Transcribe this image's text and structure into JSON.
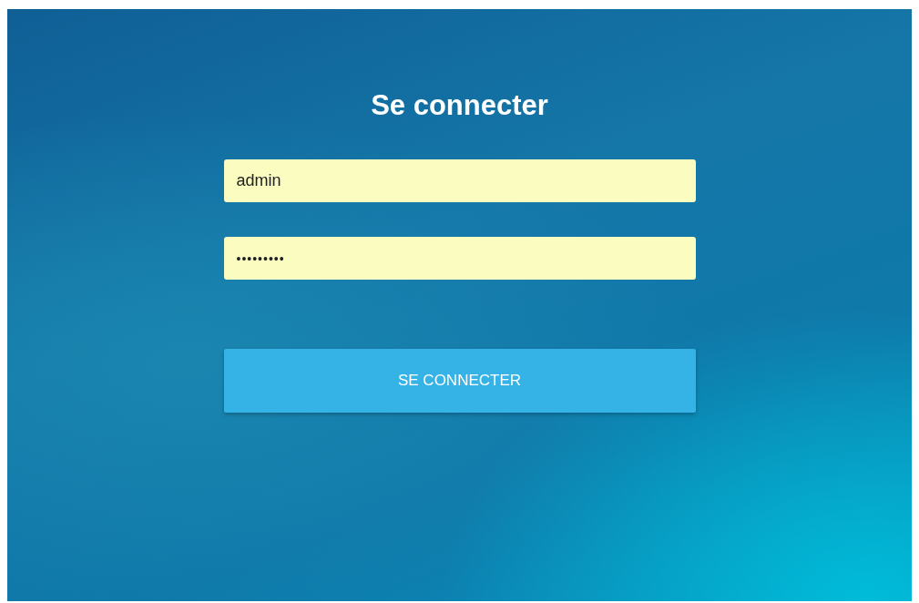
{
  "title": "Se connecter",
  "fields": [
    {
      "kind": "text",
      "value": "admin"
    },
    {
      "kind": "password",
      "value": "•••••••••"
    }
  ],
  "button": {
    "label": "SE CONNECTER"
  }
}
